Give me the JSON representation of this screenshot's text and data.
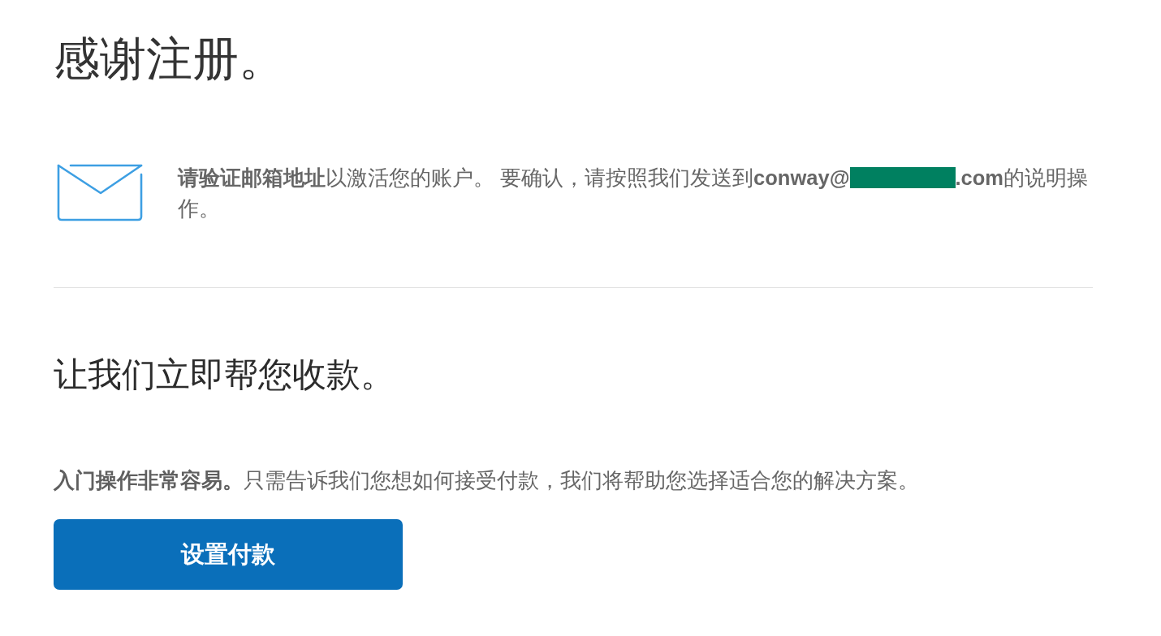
{
  "heading": "感谢注册。",
  "verification_notice": {
    "text_before_redaction": "**请验证邮箱地址**以激活您的账户。 要确认，请按照我们发送到**conway@**",
    "redacted": true,
    "text_after_redaction": "**.com**的说明操",
    "second_line": "作。"
  },
  "section_heading": "让我们立即帮您收款。",
  "intro_text": "**入门操作非常容易。**只需告诉我们您想如何接受付款，我们将帮助您选择适合您的解决方案。",
  "setup_button": {
    "label": "设置付款"
  }
}
